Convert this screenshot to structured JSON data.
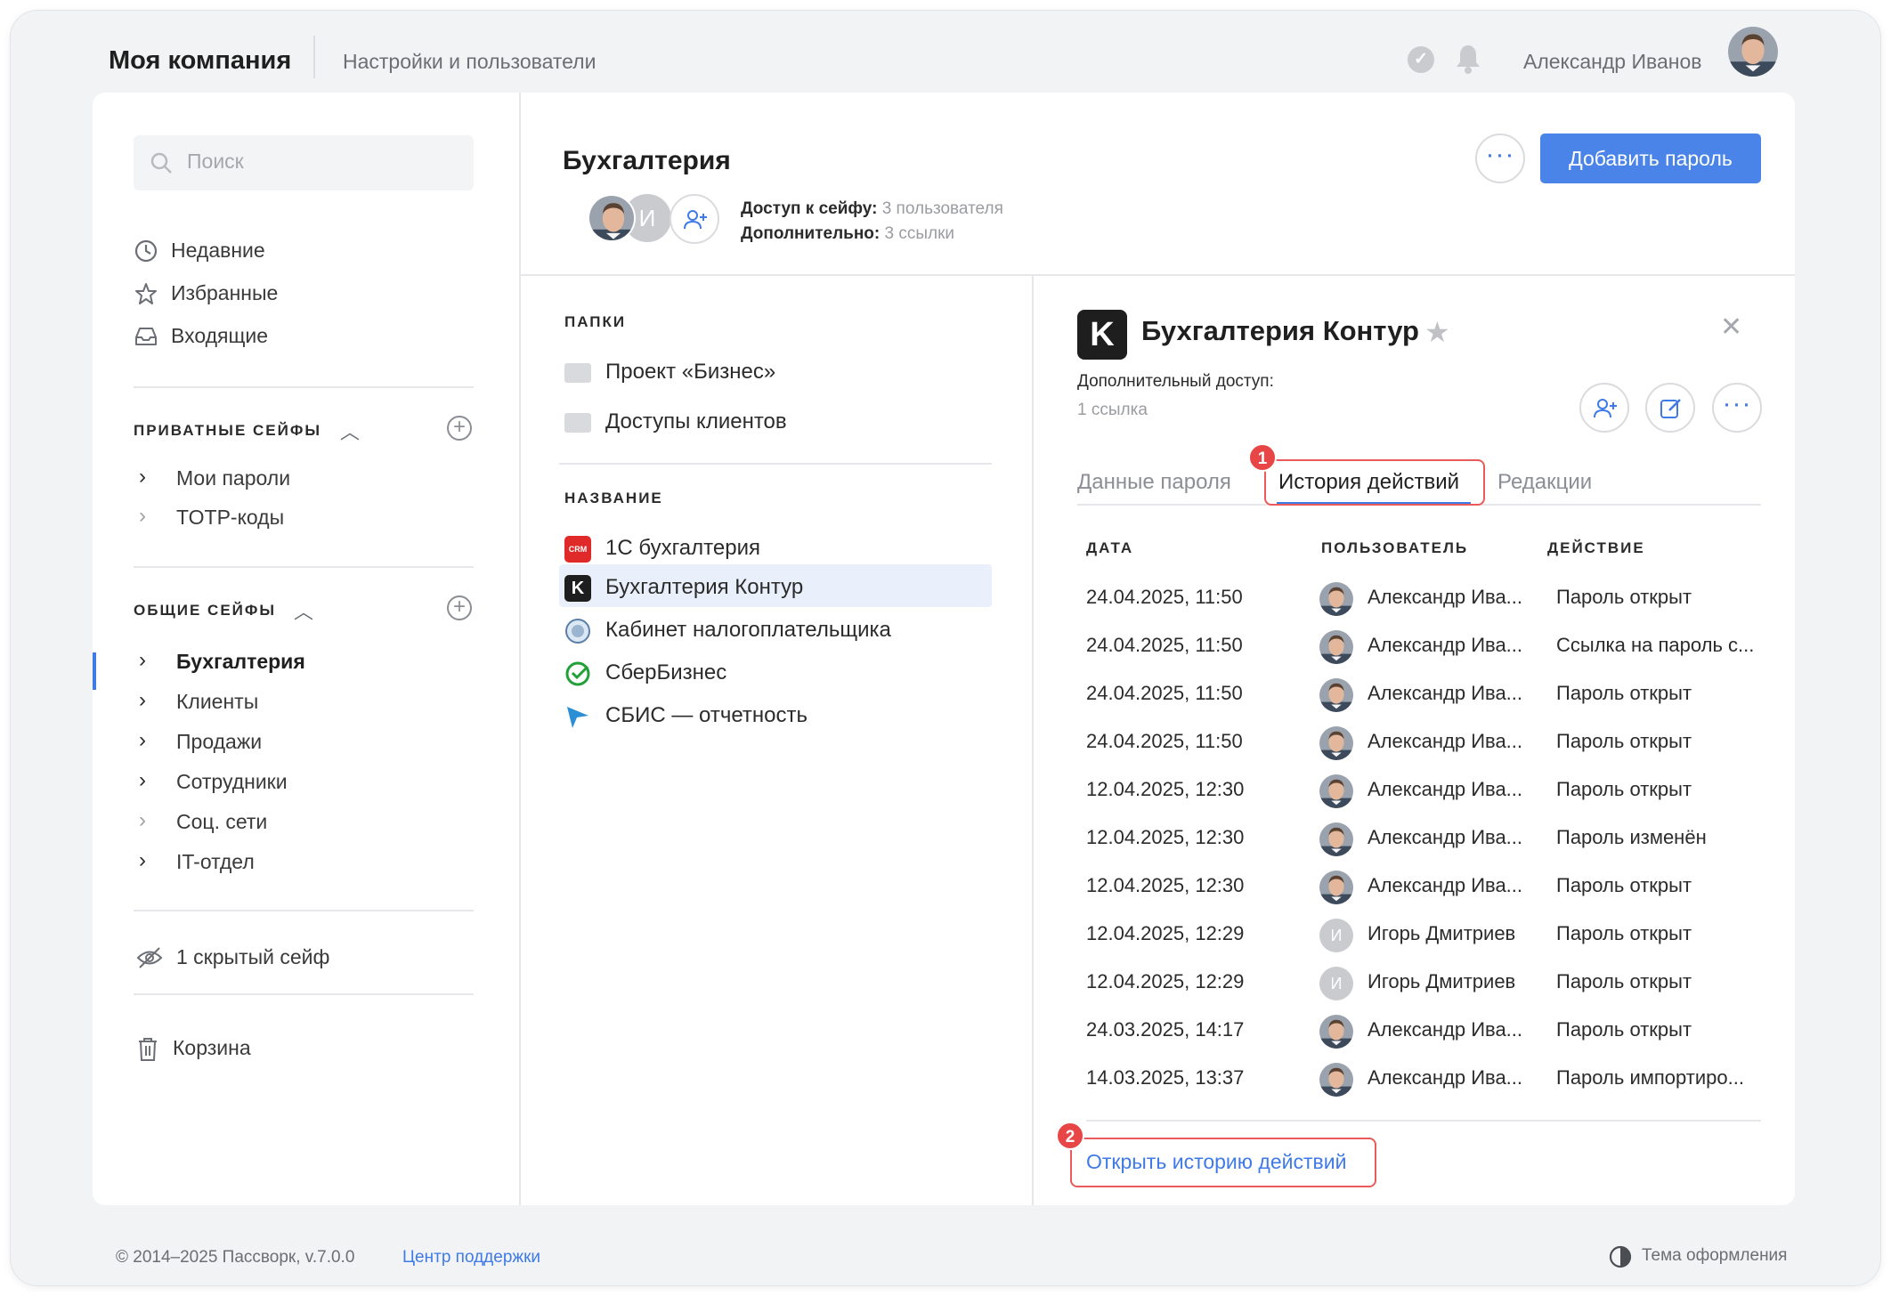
{
  "header": {
    "company": "Моя компания",
    "section": "Настройки и пользователи",
    "user_name": "Александр Иванов"
  },
  "sidebar": {
    "search_placeholder": "Поиск",
    "nav": [
      {
        "label": "Недавние",
        "icon": "clock-icon"
      },
      {
        "label": "Избранные",
        "icon": "star-icon"
      },
      {
        "label": "Входящие",
        "icon": "inbox-icon"
      }
    ],
    "private_header": "ПРИВАТНЫЕ СЕЙФЫ",
    "private_vaults": [
      "Мои пароли",
      "TOTP-коды"
    ],
    "shared_header": "ОБЩИЕ СЕЙФЫ",
    "shared_vaults": [
      "Бухгалтерия",
      "Клиенты",
      "Продажи",
      "Сотрудники",
      "Соц. сети",
      "IT-отдел"
    ],
    "hidden_vaults": "1 скрытый сейф",
    "trash": "Корзина"
  },
  "vault": {
    "title": "Бухгалтерия",
    "member_initial": "И",
    "access_label": "Доступ к сейфу:",
    "access_value": "3 пользователя",
    "extra_label": "Дополнительно:",
    "extra_value": "3 ссылки",
    "add_button": "Добавить пароль"
  },
  "folders": {
    "folders_header": "ПАПКИ",
    "folders": [
      "Проект «Бизнес»",
      "Доступы клиентов"
    ],
    "names_header": "НАЗВАНИЕ",
    "items": [
      {
        "label": "1С бухгалтерия",
        "icon_text": "CRM"
      },
      {
        "label": "Бухгалтерия Контур",
        "icon_text": "K"
      },
      {
        "label": "Кабинет налогоплательщика",
        "icon_text": ""
      },
      {
        "label": "СберБизнес",
        "icon_text": ""
      },
      {
        "label": "СБИС — отчетность",
        "icon_text": ""
      }
    ]
  },
  "detail": {
    "logo_letter": "K",
    "title": "Бухгалтерия Контур",
    "extra_access_label": "Дополнительный доступ:",
    "extra_access_value": "1 ссылка",
    "tabs": [
      "Данные пароля",
      "История действий",
      "Редакции"
    ],
    "badge1": "1",
    "badge2": "2",
    "columns": [
      "ДАТА",
      "ПОЛЬЗОВАТЕЛЬ",
      "ДЕЙСТВИЕ"
    ],
    "rows": [
      {
        "date": "24.04.2025, 11:50",
        "user": "Александр Ива...",
        "action": "Пароль открыт",
        "avatar": "photo"
      },
      {
        "date": "24.04.2025, 11:50",
        "user": "Александр Ива...",
        "action": "Ссылка на пароль с...",
        "avatar": "photo"
      },
      {
        "date": "24.04.2025, 11:50",
        "user": "Александр Ива...",
        "action": "Пароль открыт",
        "avatar": "photo"
      },
      {
        "date": "24.04.2025, 11:50",
        "user": "Александр Ива...",
        "action": "Пароль открыт",
        "avatar": "photo"
      },
      {
        "date": "12.04.2025, 12:30",
        "user": "Александр Ива...",
        "action": "Пароль открыт",
        "avatar": "photo"
      },
      {
        "date": "12.04.2025, 12:30",
        "user": "Александр Ива...",
        "action": "Пароль изменён",
        "avatar": "photo"
      },
      {
        "date": "12.04.2025, 12:30",
        "user": "Александр Ива...",
        "action": "Пароль открыт",
        "avatar": "photo"
      },
      {
        "date": "12.04.2025, 12:29",
        "user": "Игорь Дмитриев",
        "action": "Пароль открыт",
        "avatar": "И"
      },
      {
        "date": "12.04.2025, 12:29",
        "user": "Игорь Дмитриев",
        "action": "Пароль открыт",
        "avatar": "И"
      },
      {
        "date": "24.03.2025, 14:17",
        "user": "Александр Ива...",
        "action": "Пароль открыт",
        "avatar": "photo"
      },
      {
        "date": "14.03.2025, 13:37",
        "user": "Александр Ива...",
        "action": "Пароль импортиро...",
        "avatar": "photo"
      }
    ],
    "open_history_link": "Открыть историю действий"
  },
  "footer": {
    "copyright": "© 2014–2025 Пассворк, v.7.0.0",
    "support": "Центр поддержки",
    "theme": "Тема оформления"
  },
  "colors": {
    "accent": "#4b84e8",
    "link": "#3f7ae6",
    "highlight": "#e84646",
    "selected_row": "#eaf0fb"
  }
}
